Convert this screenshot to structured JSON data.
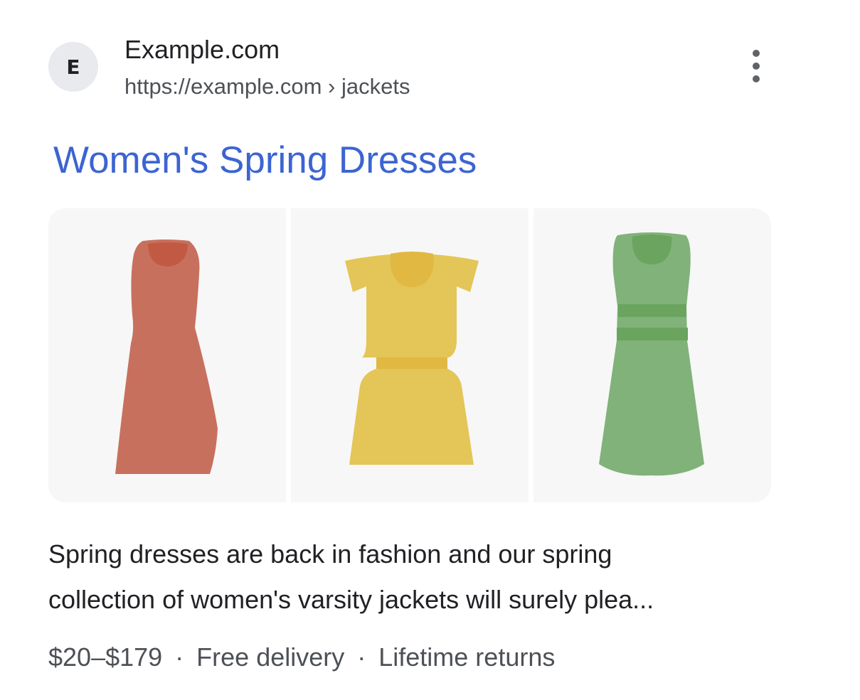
{
  "source": {
    "favicon_letter": "E",
    "site_name": "Example.com",
    "url": "https://example.com",
    "breadcrumb": "jackets",
    "breadcrumb_separator": "›"
  },
  "title": "Women's Spring Dresses",
  "images": [
    {
      "name": "red-dress-image",
      "color": "#c8705e",
      "accent": "#c25a43"
    },
    {
      "name": "yellow-dress-image",
      "color": "#e4c557",
      "accent": "#e1b841"
    },
    {
      "name": "green-dress-image",
      "color": "#80b279",
      "accent": "#6aa45f"
    }
  ],
  "snippet": {
    "line1": "Spring dresses are back in fashion and our spring",
    "line2": "collection of women's varsity jackets will surely plea..."
  },
  "meta": {
    "price": "$20–$179",
    "delivery": "Free delivery",
    "returns": "Lifetime returns",
    "separator": "·"
  },
  "colors": {
    "title_link": "#3c64d2",
    "favicon_bg": "#e8eaed",
    "tile_bg": "#f7f7f7",
    "muted_text": "#4d5156"
  },
  "icons": {
    "more": "more-vert-icon"
  }
}
